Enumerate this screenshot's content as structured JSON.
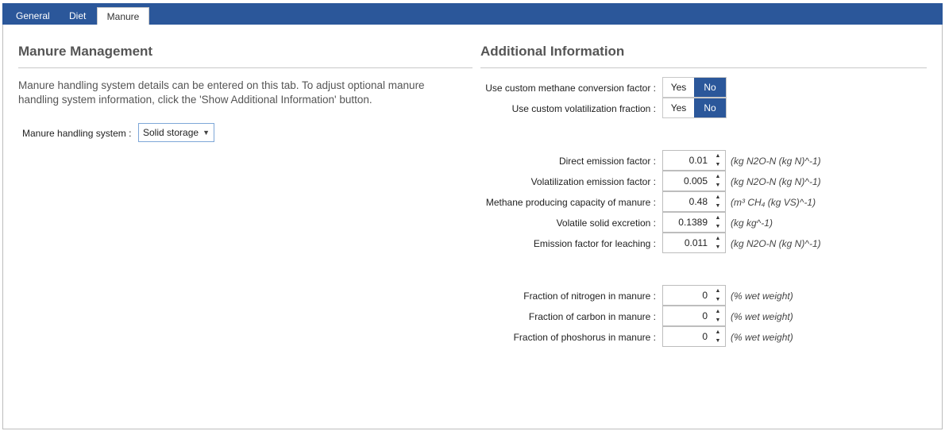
{
  "tabs": [
    {
      "label": "General"
    },
    {
      "label": "Diet"
    },
    {
      "label": "Manure"
    }
  ],
  "left": {
    "title": "Manure Management",
    "description_line1": "Manure handling system details can be entered on this tab. To adjust optional manure",
    "description_line2": "handling system information, click the 'Show Additional Information' button.",
    "system_label": "Manure handling system :",
    "system_value": "Solid storage"
  },
  "right": {
    "title": "Additional Information",
    "toggles": [
      {
        "label": "Use custom methane conversion factor :",
        "yes": "Yes",
        "no": "No",
        "selected": "No"
      },
      {
        "label": "Use custom volatilization fraction :",
        "yes": "Yes",
        "no": "No",
        "selected": "No"
      }
    ],
    "factors": [
      {
        "label": "Direct emission factor :",
        "value": "0.01",
        "unit": "(kg N2O-N (kg N)^-1)"
      },
      {
        "label": "Volatilization emission factor :",
        "value": "0.005",
        "unit": "(kg N2O-N (kg N)^-1)"
      },
      {
        "label": "Methane producing capacity of manure :",
        "value": "0.48",
        "unit": "(m³ CH₄ (kg VS)^-1)"
      },
      {
        "label": "Volatile solid excretion :",
        "value": "0.1389",
        "unit": "(kg kg^-1)"
      },
      {
        "label": "Emission factor for leaching :",
        "value": "0.011",
        "unit": "(kg N2O-N (kg N)^-1)"
      }
    ],
    "fractions": [
      {
        "label": "Fraction of nitrogen in manure :",
        "value": "0",
        "unit": "(% wet weight)"
      },
      {
        "label": "Fraction of carbon in manure :",
        "value": "0",
        "unit": "(% wet weight)"
      },
      {
        "label": "Fraction of phoshorus in manure :",
        "value": "0",
        "unit": "(% wet weight)"
      }
    ]
  },
  "colors": {
    "accent": "#2b579a"
  }
}
